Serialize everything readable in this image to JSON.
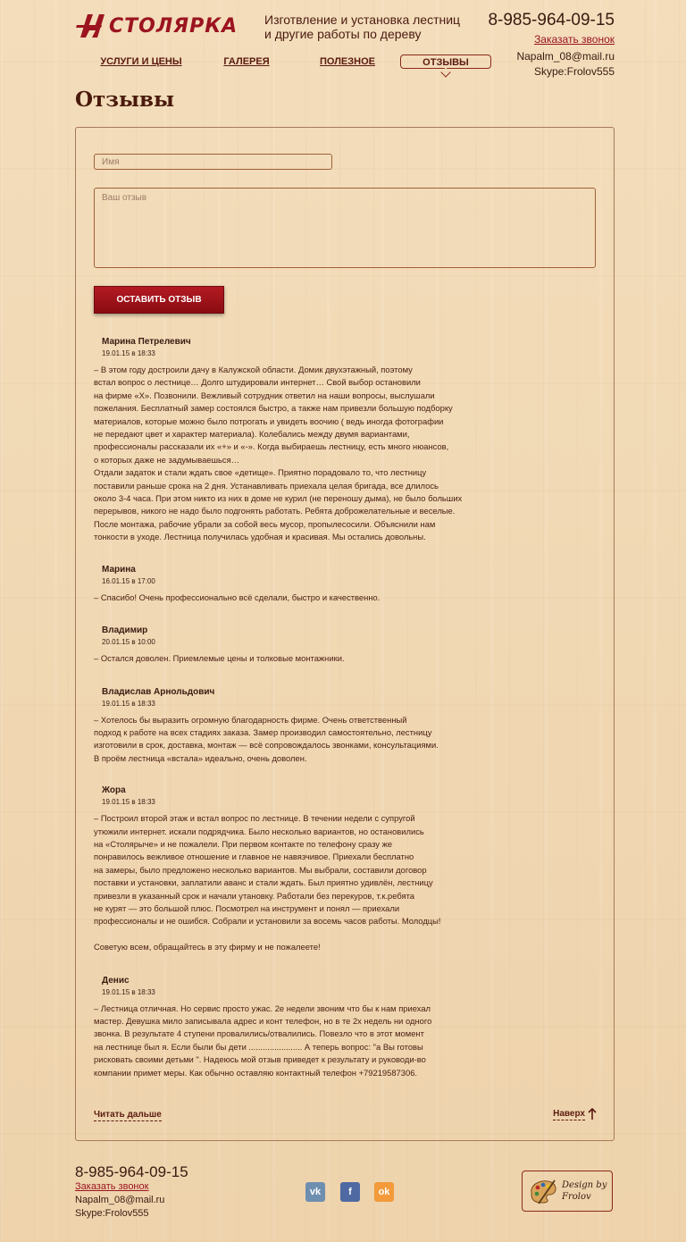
{
  "header": {
    "logo_text": "СТОЛЯРКА",
    "tagline_line1": "Изготвление и установка лестниц",
    "tagline_line2": "и другие работы по дереву",
    "phone": "8-985-964-09-15",
    "callback": "Заказать звонок",
    "email": "Napalm_08@mail.ru",
    "skype": "Skype:Frolov555"
  },
  "nav": {
    "items": [
      {
        "label": "УСЛУГИ И ЦЕНЫ"
      },
      {
        "label": "ГАЛЕРЕЯ"
      },
      {
        "label": "ПОЛЕЗНОЕ"
      },
      {
        "label": "ОТЗЫВЫ"
      }
    ],
    "active": "ОТЗЫВЫ"
  },
  "page": {
    "title": "Отзывы"
  },
  "form": {
    "name_placeholder": "Имя",
    "review_placeholder": "Ваш отзыв",
    "submit_label": "ОСТАВИТЬ ОТЗЫВ"
  },
  "reviews": [
    {
      "name": "Марина Петрелевич",
      "date": "19.01.15 в 18:33",
      "text": "– В этом году достроили дачу в Калужской области.  Домик двухэтажный, поэтому\nвстал вопрос о лестнице… Долго штудировали интернет…  Свой выбор остановили\nна фирме «Х».  Позвонили. Вежливый сотрудник ответил на наши вопросы, выслушали\nпожелания. Бесплатный замер состоялся быстро, а также нам привезли  большую подборку\nматериалов, которые можно было потрогать и увидеть воочию ( ведь иногда фотографии\n не передают цвет и характер материала).  Колебались между двумя вариантами,\nпрофессионалы рассказали их «+» и «-».  Когда выбираешь лестницу, есть много нюансов,\nо которых даже не задумываешься…\nОтдали задаток и стали ждать свое «детище».  Приятно порадовало то, что лестницу\nпоставили раньше срока на 2 дня. Устанавливать приехала целая бригада, все длилось\nоколо 3-4 часа. При этом никто из них в доме не курил (не переношу дыма), не было больших\nперерывов, никого не надо было подгонять работать.  Ребята доброжелательные и веселые.\n После монтажа, рабочие убрали за собой весь мусор, пропылесосили. Объяснили нам\nтонкости в уходе.  Лестница получилась удобная и красивая. Мы остались довольны."
    },
    {
      "name": "Марина",
      "date": "16.01.15 в 17:00",
      "text": "– Спасибо! Очень профессионально всё сделали, быстро и качественно."
    },
    {
      "name": "Владимир",
      "date": "20.01.15 в 10:00",
      "text": "– Остался доволен. Приемлемые цены и толковые монтажники."
    },
    {
      "name": "Владислав Арнольдович",
      "date": "19.01.15 в 18:33",
      "text": "– Хотелось бы выразить огромную благодарность фирме. Очень ответственный\nподход к работе на всех стадиях заказа. Замер производил самостоятельно, лестницу\nизготовили в срок, доставка, монтаж — всё сопровождалось звонками, консультациями.\nВ проём лестница «встала» идеально, очень доволен."
    },
    {
      "name": "Жора",
      "date": "19.01.15 в 18:33",
      "text": "– Построил второй этаж и встал вопрос по лестнице. В течении недели с супругой\nутюжили интернет. искали подрядчика. Было несколько вариантов, но остановились\n на «Столярыче» и не пожалели. При первом контакте по телефону сразу же\nпонравилось вежливое отношение и главное не навязчивое. Приехали бесплатно\nна замеры, было предложено несколько вариантов. Мы выбрали, составили договор\nпоставки и установки, заплатили аванс и стали ждать. Был приятно удивлён, лестницу\nпривезли в указанный срок и начали утановку. Работали без перекуров, т.к.ребята\n не курят — это большой плюс. Посмотрел на инструмент и понял — приехали\nпрофессионалы и не ошибся. Собрали и установили за восемь часов работы. Молодцы!\n\nСоветую всем, обращайтесь в эту фирму и не пожалеете!"
    },
    {
      "name": "Денис",
      "date": "19.01.15 в 18:33",
      "text": "– Лестница отличная. Но сервис просто ужас. 2е недели звоним что бы к нам приехал\nмастер. Девушка мило записывала адрес и конт телефон, но в те 2х недель ни одного\nзвонка. В результате 4 ступени провалились/отвалились. Повезло что в этот момент\nна лестнице был я. Если были бы дети ....................... А теперь вопрос: \"а Вы готовы\nрисковать своими детьми \". Надеюсь мой отзыв приведет к результату и руководи-во\nкомпании примет меры. Как обычно оставляю контактный телефон +79219587306."
    }
  ],
  "links": {
    "read_more": "Читать дальше",
    "to_top": "Наверх"
  },
  "footer": {
    "phone": "8-985-964-09-15",
    "callback": "Заказать звонок",
    "email": "Napalm_08@mail.ru",
    "skype": "Skype:Frolov555",
    "social": [
      {
        "icon": "vk-icon",
        "glyph": "vk",
        "color": "#6f8fb0"
      },
      {
        "icon": "facebook-icon",
        "glyph": "f",
        "color": "#4f6aa3"
      },
      {
        "icon": "odnoklassniki-icon",
        "glyph": "ok",
        "color": "#f39a3a"
      }
    ],
    "designer_line1": "Design by",
    "designer_line2": "Frolov"
  },
  "colors": {
    "brand_red": "#9b1420",
    "button_red": "#a01019",
    "text_brown": "#3a1a10",
    "wood_bg": "#f1d9b5"
  }
}
